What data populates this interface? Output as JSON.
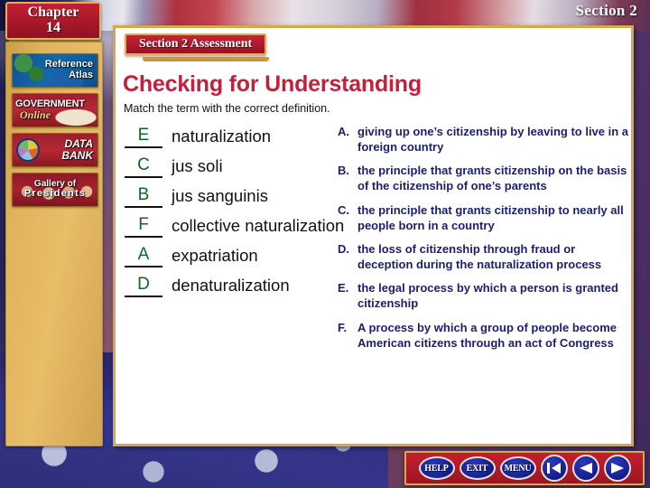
{
  "window": {
    "chapter_word": "Chapter",
    "chapter_number": "14",
    "section_label": "Section 2"
  },
  "sidebar": {
    "items": [
      {
        "id": "reference-atlas",
        "line1": "Reference",
        "line2": "Atlas"
      },
      {
        "id": "government-online",
        "line1": "GOVERNMENT",
        "line2": "Online"
      },
      {
        "id": "data-bank",
        "line1": "DATA",
        "line2": "BANK"
      },
      {
        "id": "gallery-presidents",
        "line1": "Gallery of",
        "line2": "Presidents"
      }
    ]
  },
  "content": {
    "assessment_banner": "Section 2 Assessment",
    "heading": "Checking for Understanding",
    "subheading": "Match the term with the correct definition.",
    "terms": [
      {
        "answer": "E",
        "term": "naturalization"
      },
      {
        "answer": "C",
        "term": "jus soli"
      },
      {
        "answer": "B",
        "term": "jus sanguinis"
      },
      {
        "answer": "F",
        "term": "collective naturalization"
      },
      {
        "answer": "A",
        "term": "expatriation"
      },
      {
        "answer": "D",
        "term": "denaturalization"
      }
    ],
    "definitions": [
      {
        "letter": "A.",
        "text": "giving up one’s citizenship by leaving to live in a foreign country"
      },
      {
        "letter": "B.",
        "text": "the principle that grants citizenship on the basis of the citizenship of one’s parents"
      },
      {
        "letter": "C.",
        "text": "the principle that grants citizenship to nearly all people born in a country"
      },
      {
        "letter": "D.",
        "text": "the loss of citizenship through fraud or deception during the naturalization process"
      },
      {
        "letter": "E.",
        "text": "the legal process by which a person is granted citizenship"
      },
      {
        "letter": "F.",
        "text": "A process by which a group of people become American citizens through an act of Congress"
      }
    ]
  },
  "navbar": {
    "buttons": [
      {
        "id": "help-button",
        "label": "HELP",
        "kind": "pill"
      },
      {
        "id": "exit-button",
        "label": "EXIT",
        "kind": "pill"
      },
      {
        "id": "menu-button",
        "label": "MENU",
        "kind": "pill"
      },
      {
        "id": "first-slide-button",
        "icon": "first-arrow-icon",
        "kind": "circle"
      },
      {
        "id": "previous-slide-button",
        "icon": "left-arrow-icon",
        "kind": "circle"
      },
      {
        "id": "next-slide-button",
        "icon": "right-arrow-icon",
        "kind": "circle"
      }
    ]
  },
  "colors": {
    "crimson": "#c2203c",
    "banner_red": "#ab1a2b",
    "gold": "#d4a94e",
    "answer_green": "#0b6b24",
    "definition_navy": "#1b1f6e"
  }
}
